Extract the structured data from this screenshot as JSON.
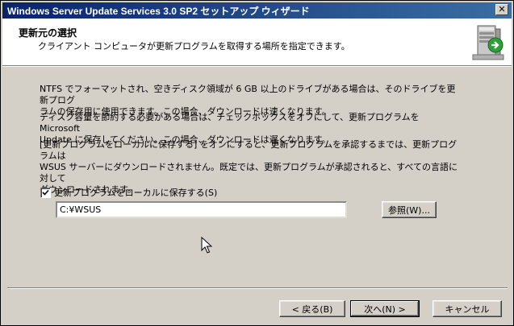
{
  "window": {
    "title": "Windows Server Update Services 3.0 SP2 セットアップ ウィザード",
    "close_label": "✕"
  },
  "header": {
    "title": "更新元の選択",
    "subtitle": "クライアント コンピュータが更新プログラムを取得する場所を指定できます。",
    "icon": "server-install-icon"
  },
  "body": {
    "paragraph1": [
      "NTFS でフォーマットされ、空きディスク領域が 6 GB 以上のドライブがある場合は、そのドライブを更新プログ",
      "ラムの保存用に使用できます。この場合、ダウンロードは速くなります。"
    ],
    "paragraph2": [
      "ディスク容量を節約する必要がある場合は、チェックボックスをオフにして、更新プログラムを Microsoft",
      "Update に保存してください。この場合、ダウンロードは遅くなります。"
    ],
    "paragraph3": [
      "[更新プログラムをローカルに保存する] をオンにすると、更新プログラムを承認するまでは、更新プログラムは",
      "WSUS サーバーにダウンロードされません。既定では、更新プログラムが承認されると、すべての言語に対して",
      "ダウンロードされます。"
    ],
    "store_locally_label": "更新プログラムをローカルに保存する(S)",
    "store_locally_checked": true,
    "path_value": "C:¥WSUS",
    "browse_label": "参照(W)..."
  },
  "footer": {
    "back_label": "< 戻る(B)",
    "next_label": "次へ(N) >",
    "cancel_label": "キャンセル"
  }
}
